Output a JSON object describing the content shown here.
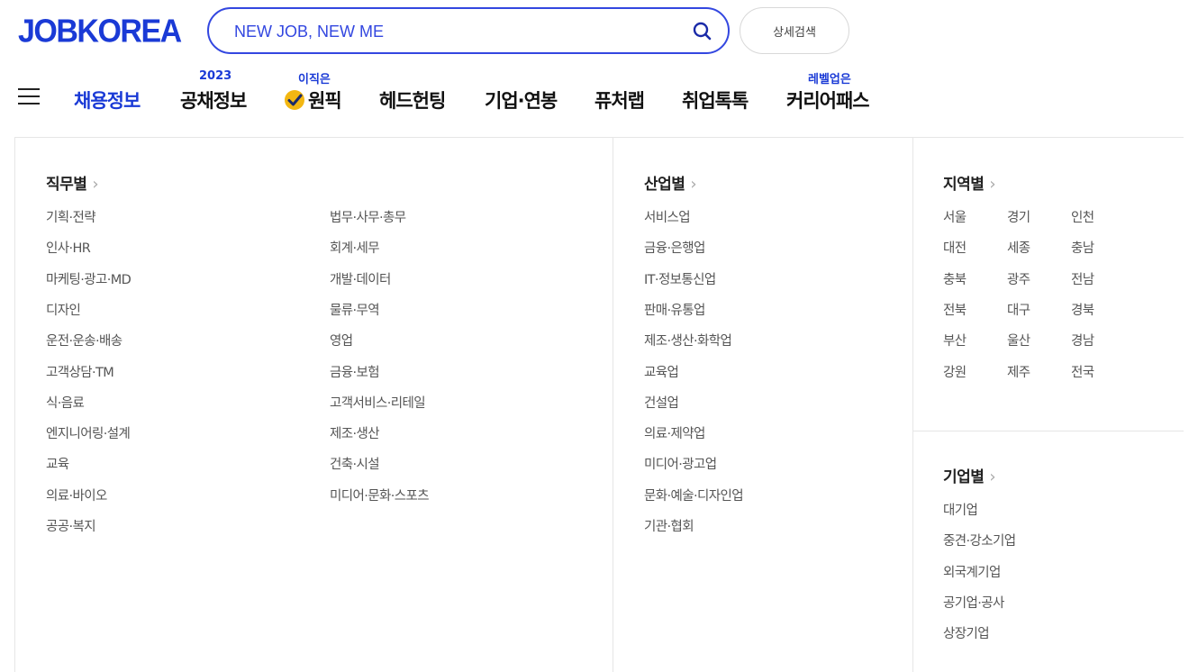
{
  "logo": "JOBKOREA",
  "search": {
    "value": "NEW JOB, NEW ME",
    "icon": "search-icon"
  },
  "advanced_search_label": "상세검색",
  "nav": {
    "items": [
      {
        "label": "채용정보",
        "active": true
      },
      {
        "label": "공채정보",
        "badge": "2023"
      },
      {
        "label": "원픽",
        "badge": "이직은",
        "icon": "check-icon"
      },
      {
        "label": "헤드헌팅"
      },
      {
        "label": "기업·연봉"
      },
      {
        "label": "퓨처랩"
      },
      {
        "label": "취업톡톡"
      },
      {
        "label": "커리어패스",
        "badge": "레벨업은"
      }
    ]
  },
  "sections": {
    "job": {
      "title": "직무별",
      "col1": [
        "기획·전략",
        "인사·HR",
        "마케팅·광고·MD",
        "디자인",
        "운전·운송·배송",
        "고객상담·TM",
        "식·음료",
        "엔지니어링·설계",
        "교육",
        "의료·바이오",
        "공공·복지"
      ],
      "col2": [
        "법무·사무·총무",
        "회계·세무",
        "개발·데이터",
        "물류·무역",
        "영업",
        "금융·보험",
        "고객서비스·리테일",
        "제조·생산",
        "건축·시설",
        "미디어·문화·스포츠"
      ]
    },
    "industry": {
      "title": "산업별",
      "items": [
        "서비스업",
        "금융·은행업",
        "IT·정보통신업",
        "판매·유통업",
        "제조·생산·화학업",
        "교육업",
        "건설업",
        "의료·제약업",
        "미디어·광고업",
        "문화·예술·디자인업",
        "기관·협회"
      ]
    },
    "region": {
      "title": "지역별",
      "items": [
        "서울",
        "경기",
        "인천",
        "대전",
        "세종",
        "충남",
        "충북",
        "광주",
        "전남",
        "전북",
        "대구",
        "경북",
        "부산",
        "울산",
        "경남",
        "강원",
        "제주",
        "전국"
      ]
    },
    "company": {
      "title": "기업별",
      "items": [
        "대기업",
        "중견·강소기업",
        "외국계기업",
        "공기업·공사",
        "상장기업"
      ]
    }
  }
}
